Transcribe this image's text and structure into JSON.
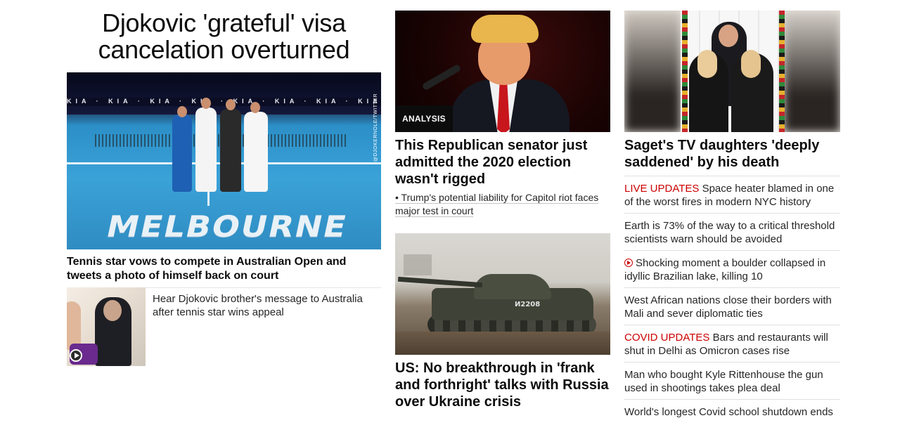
{
  "lead": {
    "headline": "Djokovic 'grateful' visa cancelation overturned",
    "image_text": "MELBOURNE",
    "image_credit": "@DJOKERNOLE/TWITTER",
    "subheadline": "Tennis star vows to compete in Australian Open and tweets a photo of himself back on court",
    "video_text": "Hear Djokovic brother's message to Australia after tennis star wins appeal"
  },
  "middle": {
    "badge": "ANALYSIS",
    "headline1": "This Republican senator just admitted the 2020 election wasn't rigged",
    "related1": "• Trump's potential liability for Capitol riot faces major test in court",
    "tank_marking": "И2208",
    "headline2": "US: No breakthrough in 'frank and forthright' talks with Russia over Ukraine crisis"
  },
  "right": {
    "headline": "Saget's TV daughters 'deeply saddened' by his death",
    "items": [
      {
        "tag": "LIVE UPDATES",
        "text": " Space heater blamed in one of the worst fires in modern NYC history"
      },
      {
        "tag": "",
        "text": "Earth is 73% of the way to a critical threshold scientists warn should be avoided"
      },
      {
        "tag": "",
        "text": "Shocking moment a boulder collapsed in idyllic Brazilian lake, killing 10",
        "video": true
      },
      {
        "tag": "",
        "text": "West African nations close their borders with Mali and sever diplomatic ties"
      },
      {
        "tag": "COVID UPDATES",
        "text": " Bars and restaurants will shut in Delhi as Omicron cases rise"
      },
      {
        "tag": "",
        "text": "Man who bought Kyle Rittenhouse the gun used in shootings takes plea deal"
      },
      {
        "tag": "",
        "text": "World's longest Covid school shutdown ends"
      }
    ]
  },
  "colors": {
    "text": "#0c0c0c",
    "secondary_text": "#262626",
    "tag_red": "#cc0000",
    "divider": "#e0e0e0"
  }
}
